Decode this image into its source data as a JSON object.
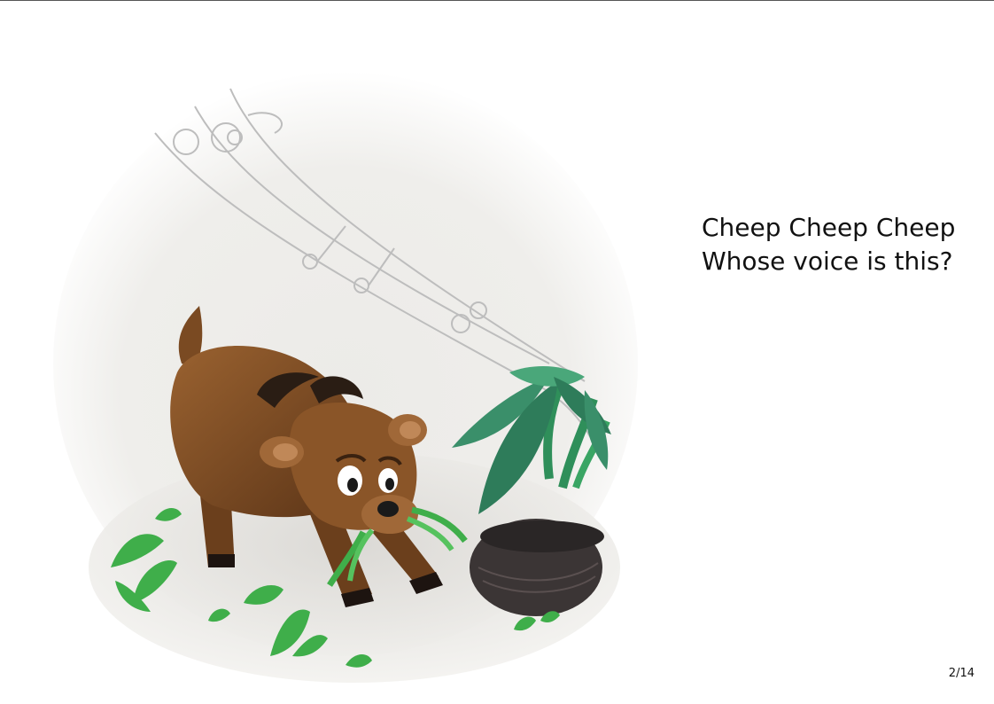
{
  "story": {
    "line1": "Cheep Cheep Cheep",
    "line2": "Whose voice is this?"
  },
  "page_number": "2/14",
  "colors": {
    "goat_brown": "#7a4a22",
    "leaf_green": "#3fae4a",
    "plant_teal": "#3a8f6a",
    "nest_dark": "#3b3535",
    "ground_grey": "#e6e4e0"
  }
}
